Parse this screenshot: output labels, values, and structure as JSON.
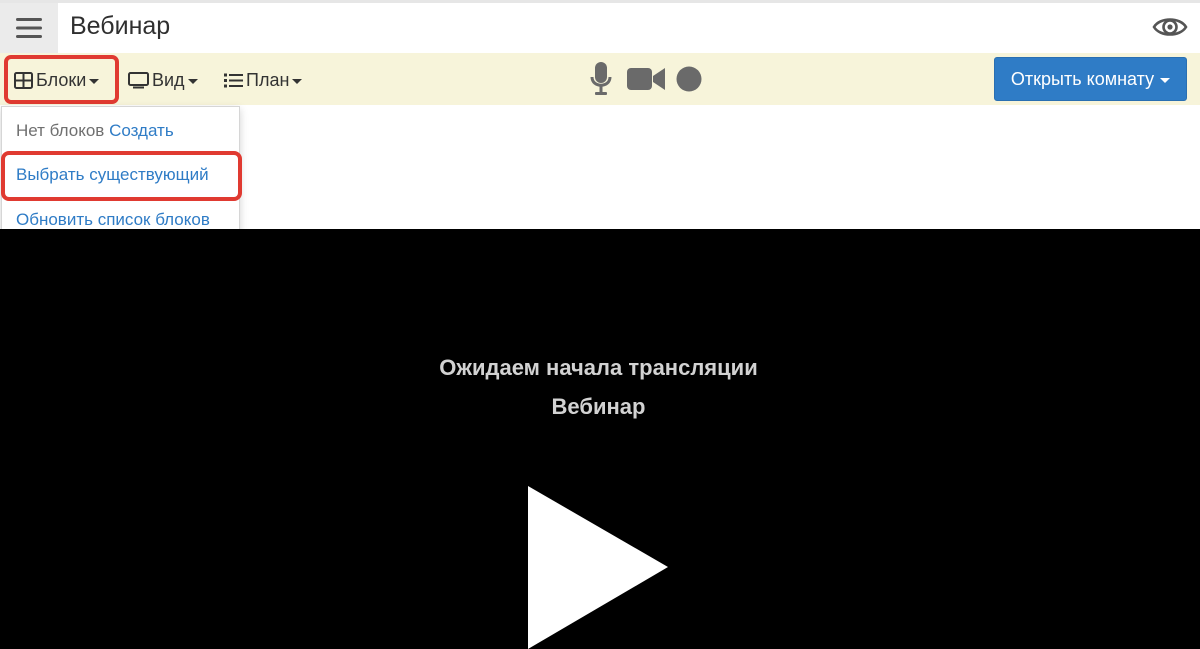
{
  "header": {
    "title": "Вебинар"
  },
  "toolbar": {
    "blocks_label": "Блоки",
    "view_label": "Вид",
    "plan_label": "План",
    "open_room_label": "Открыть комнату"
  },
  "dropdown": {
    "no_blocks_text": "Нет блоков",
    "create_link": "Создать",
    "choose_existing": "Выбрать существующий",
    "refresh_list": "Обновить список блоков"
  },
  "player": {
    "waiting_text": "Ожидаем начала трансляции",
    "event_title": "Вебинар"
  },
  "colors": {
    "toolbar_bg": "#f7f4da",
    "accent_blue": "#2f7cc6",
    "highlight_red": "#e03a31",
    "player_bg": "#000000"
  },
  "icons": [
    "menu-icon",
    "eye-icon",
    "grid-icon",
    "monitor-icon",
    "list-icon",
    "microphone-icon",
    "camera-icon",
    "record-icon",
    "play-icon"
  ]
}
